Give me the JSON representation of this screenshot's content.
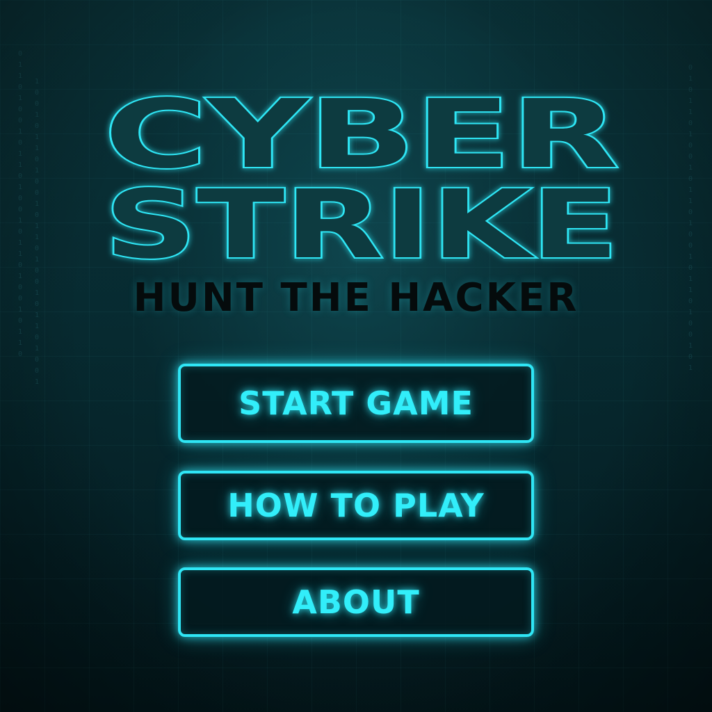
{
  "title": {
    "line1": "CYBER",
    "line2": "STRIKE"
  },
  "subtitle": "HUNT THE HACKER",
  "menu": {
    "start_label": "START GAME",
    "how_to_play_label": "HOW TO PLAY",
    "about_label": "ABOUT"
  },
  "colors": {
    "accent": "#2fe6f5",
    "background": "#062227",
    "subtitle": "#050b0c"
  },
  "decor": {
    "code_rain_left": "0110100101101001011010010110",
    "code_rain_left2": "1001011010010110100101101001",
    "code_rain_right": "0101101001011010010110100101"
  }
}
